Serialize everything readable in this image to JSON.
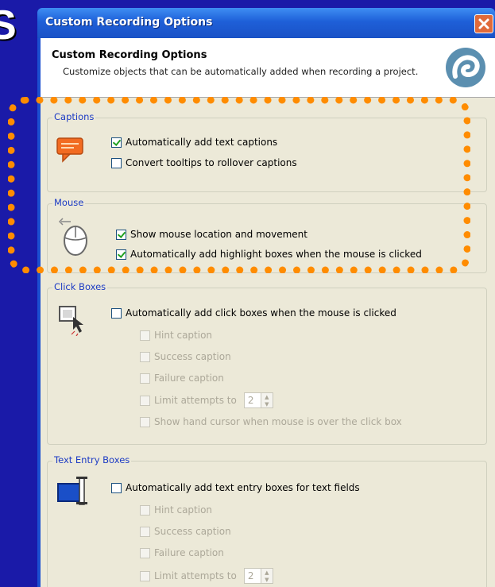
{
  "slide": {
    "letter": "S"
  },
  "window": {
    "title": "Custom Recording Options"
  },
  "header": {
    "title": "Custom Recording Options",
    "description": "Customize objects that can be automatically added when recording a project."
  },
  "groups": {
    "captions": {
      "title": "Captions",
      "options": [
        {
          "label": "Automatically add text captions",
          "checked": true
        },
        {
          "label": "Convert tooltips to rollover captions",
          "checked": false
        }
      ]
    },
    "mouse": {
      "title": "Mouse",
      "options": [
        {
          "label": "Show mouse location and movement",
          "checked": true
        },
        {
          "label": "Automatically add highlight boxes when the mouse is clicked",
          "checked": true
        }
      ]
    },
    "click_boxes": {
      "title": "Click Boxes",
      "main": {
        "label": "Automatically add click boxes when the mouse is clicked",
        "checked": false
      },
      "sub": [
        {
          "label": "Hint caption"
        },
        {
          "label": "Success caption"
        },
        {
          "label": "Failure caption"
        },
        {
          "label": "Limit attempts to",
          "value": "2"
        },
        {
          "label": "Show hand cursor when mouse is over the click box"
        }
      ]
    },
    "text_entry_boxes": {
      "title": "Text Entry Boxes",
      "main": {
        "label": "Automatically add text entry boxes for text fields",
        "checked": false
      },
      "sub": [
        {
          "label": "Hint caption"
        },
        {
          "label": "Success caption"
        },
        {
          "label": "Failure caption"
        },
        {
          "label": "Limit attempts to",
          "value": "2"
        }
      ]
    }
  },
  "colors": {
    "background": "#1a1aa8",
    "titlebar": "#1e5fd8",
    "highlight": "#ff8c00",
    "group_title": "#1c3bc4",
    "dialog_face": "#ece9d8"
  }
}
